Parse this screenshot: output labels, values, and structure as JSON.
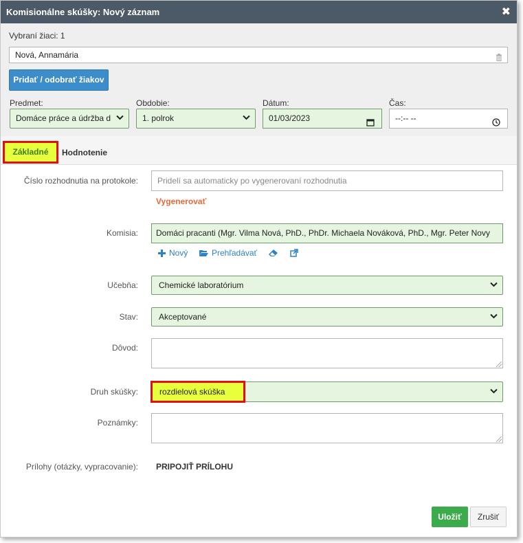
{
  "dialog": {
    "title": "Komisionálne skúšky: Nový záznam",
    "close_glyph": "✖"
  },
  "top": {
    "selected_students_label": "Vybraní žiaci: 1",
    "student_name": "Nová, Annamária",
    "add_remove_button": "Pridať / odobrať žiakov",
    "subject_label": "Predmet:",
    "subject_value": "Domáce práce a údržba d",
    "period_label": "Obdobie:",
    "period_value": "1. polrok",
    "date_label": "Dátum:",
    "date_value": "01/03/2023",
    "time_label": "Čas:",
    "time_value": "--:-- --"
  },
  "tabs": {
    "basic": "Základné",
    "evaluation": "Hodnotenie"
  },
  "form": {
    "decision_number_label": "Číslo rozhodnutia na protokole:",
    "decision_number_placeholder": "Pridelí sa automaticky po vygenerovaní rozhodnutia",
    "generate_link": "Vygenerovať",
    "commission_label": "Komisia:",
    "commission_value": "Domáci pracanti (Mgr.  Vilma Nová, PhD., PhDr.  Michaela Nováková, PhD., Mgr.  Peter Novy",
    "commission_new": "Nový",
    "commission_browse": "Prehľadávať",
    "classroom_label": "Učebňa:",
    "classroom_value": "Chemické laboratórium",
    "state_label": "Stav:",
    "state_value": "Akceptované",
    "reason_label": "Dôvod:",
    "exam_type_label": "Druh skúšky:",
    "exam_type_value": "rozdielová skúška",
    "notes_label": "Poznámky:",
    "attachments_label": "Prílohy (otázky, vypracovanie):",
    "attach_button": "PRIPOJIŤ PRÍLOHU"
  },
  "footer": {
    "save": "Uložiť",
    "cancel": "Zrušiť"
  },
  "icons": {
    "close": "close-icon",
    "trash": "trash-icon",
    "plus": "plus-icon",
    "folder": "folder-open-icon",
    "eraser": "eraser-icon",
    "external": "external-link-icon",
    "calendar": "calendar-icon",
    "clock": "clock-icon"
  },
  "colors": {
    "titlebar": "#4b5a66",
    "primary_button": "#3c8dc9",
    "field_green": "#e5f5e0",
    "highlight": "#e8ff3c",
    "highlight_border": "#e01010",
    "save_button": "#3cab4b",
    "generate_link": "#e8683a",
    "toolbar_link": "#2d82c4"
  }
}
